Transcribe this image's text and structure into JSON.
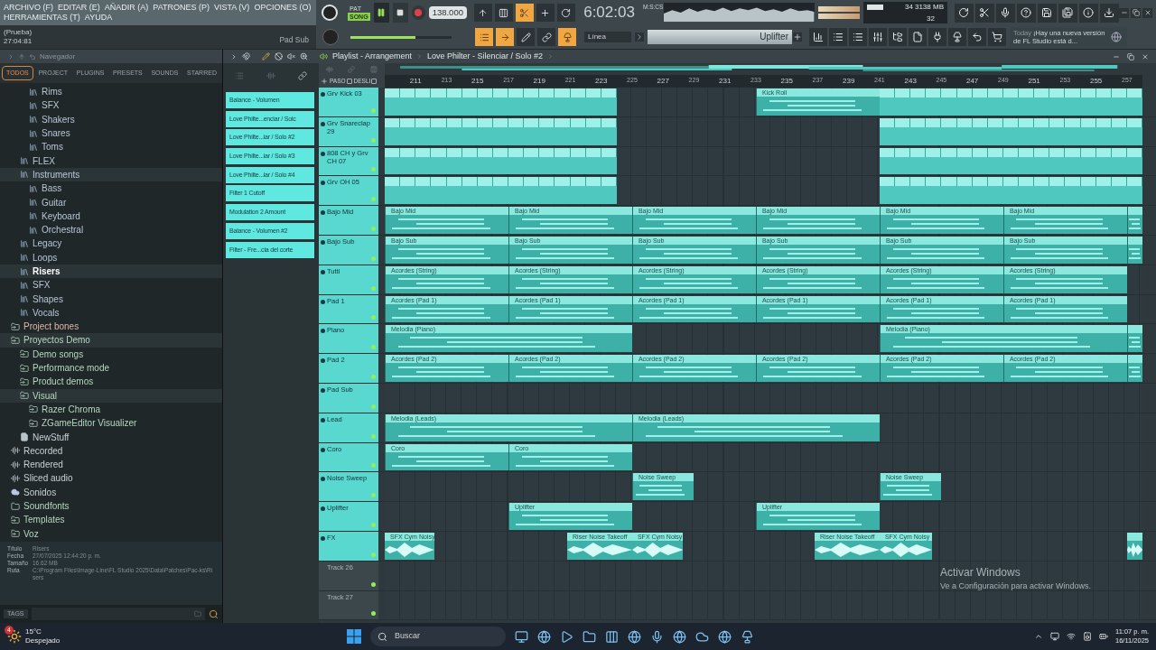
{
  "menu": [
    "ARCHIVO (F)",
    "EDITAR (E)",
    "AÑADIR (A)",
    "PATRONES (P)",
    "VISTA (V)",
    "OPCIONES (O)",
    "HERRAMIENTAS (T)",
    "AYUDA"
  ],
  "hint": {
    "title": "(Prueba)",
    "value": "27:04:81",
    "channel": "Pad Sub"
  },
  "transport": {
    "modes": [
      {
        "label": "PAT",
        "selected": false
      },
      {
        "label": "SONG",
        "selected": true
      }
    ],
    "playing": true,
    "tempo": "138.000",
    "time": "6:02:03",
    "time_unit": "M:S:CS"
  },
  "master_volume": {
    "level": 0.64
  },
  "cpu": {
    "cpu": "34",
    "memory": "3138 MB",
    "polyphony": "32"
  },
  "snap": "Línea",
  "pattern": "Uplifter",
  "news": {
    "day": "Today",
    "text": "¡Hay una nueva versión de FL Studio está d..."
  },
  "browser": {
    "title": "Navegador",
    "tabs": [
      {
        "label": "TODOS",
        "selected": true
      },
      {
        "label": "PROJECT",
        "selected": false
      },
      {
        "label": "PLUGINS",
        "selected": false
      },
      {
        "label": "PRESETS",
        "selected": false
      },
      {
        "label": "SOUNDS",
        "selected": false
      },
      {
        "label": "STARRED",
        "selected": false
      }
    ],
    "tree": [
      {
        "children": [
          {
            "children": [
              {
                "label": "Rims",
                "kind": "pack",
                "selected": false
              },
              {
                "label": "SFX",
                "kind": "pack",
                "selected": false
              },
              {
                "label": "Shakers",
                "kind": "pack",
                "selected": false
              },
              {
                "label": "Snares",
                "kind": "pack",
                "selected": false
              },
              {
                "label": "Toms",
                "kind": "pack",
                "selected": false
              }
            ]
          },
          {
            "label": "FLEX",
            "kind": "pack",
            "selected": false
          },
          {
            "label": "Instruments",
            "kind": "pack",
            "selected": false,
            "children": [
              {
                "label": "Bass",
                "kind": "pack",
                "selected": false
              },
              {
                "label": "Guitar",
                "kind": "pack",
                "selected": false
              },
              {
                "label": "Keyboard",
                "kind": "pack",
                "selected": false
              },
              {
                "label": "Orchestral",
                "kind": "pack",
                "selected": false
              }
            ]
          },
          {
            "label": "Legacy",
            "kind": "pack",
            "selected": false
          },
          {
            "label": "Loops",
            "kind": "pack",
            "selected": false
          },
          {
            "label": "Risers",
            "kind": "pack",
            "selected": true
          },
          {
            "label": "SFX",
            "kind": "pack",
            "selected": false
          },
          {
            "label": "Shapes",
            "kind": "pack",
            "selected": false
          },
          {
            "label": "Vocals",
            "kind": "pack",
            "selected": false
          }
        ]
      },
      {
        "label": "Project bones",
        "kind": "bones",
        "selected": false
      },
      {
        "label": "Proyectos Demo",
        "kind": "folder",
        "selected": false,
        "children": [
          {
            "label": "Demo songs",
            "kind": "folder",
            "selected": false
          },
          {
            "label": "Performance mode",
            "kind": "folder",
            "selected": false
          },
          {
            "label": "Product demos",
            "kind": "folder",
            "selected": false
          },
          {
            "label": "Visual",
            "kind": "folder",
            "selected": false,
            "children": [
              {
                "label": "Razer Chroma",
                "kind": "folder",
                "selected": false
              },
              {
                "label": "ZGameEditor Visualizer",
                "kind": "folder",
                "selected": false
              }
            ]
          },
          {
            "label": "NewStuff",
            "kind": "file",
            "selected": false
          }
        ]
      },
      {
        "label": "Recorded",
        "kind": "audio",
        "selected": false
      },
      {
        "label": "Rendered",
        "kind": "audio",
        "selected": false
      },
      {
        "label": "Sliced audio",
        "kind": "audio",
        "selected": false
      },
      {
        "label": "Sonidos",
        "kind": "cloud",
        "selected": false
      },
      {
        "label": "Soundfonts",
        "kind": "plain",
        "selected": false
      },
      {
        "label": "Templates",
        "kind": "folder",
        "selected": false
      },
      {
        "label": "Voz",
        "kind": "folder",
        "selected": false
      }
    ],
    "info": [
      {
        "label": "Título",
        "value": "Risers"
      },
      {
        "label": "Fecha",
        "value": "27/07/2025 12:44:20 p. m."
      },
      {
        "label": "Tamaño",
        "value": "16.62 MB"
      },
      {
        "label": "Ruta",
        "value": "C:\\Program Files\\Image-Line\\FL Studio 2025\\Data\\Patches\\Pac-ks\\Risers"
      }
    ],
    "tags": "TAGS"
  },
  "playlist": {
    "title": "Playlist - Arrangement",
    "pattern": "Love Philter - Silenciar / Solo #2",
    "step_labels": [
      "PASO",
      "DESLI"
    ],
    "automation": [
      "Balance - Volumen",
      "Love Philte...enciar / Solc",
      "Love Philte...iar / Solo #2",
      "Love Philte...iar / Solo #3",
      "Love Philte...iar / Solo #4",
      "Filter 1 Cutoff",
      "Modulation 2 Amount",
      "Balance - Volumen #2",
      "Filter - Fre...cia del corte"
    ],
    "ruler": [
      "211",
      "213",
      "215",
      "217",
      "219",
      "221",
      "223",
      "225",
      "227",
      "229",
      "231",
      "233",
      "235",
      "237",
      "239",
      "241",
      "243",
      "245",
      "247",
      "249",
      "251",
      "253",
      "255",
      "257"
    ],
    "tracks": [
      {
        "name": "Grv Kick 03",
        "kind": "named",
        "clips": [
          {
            "kind": "beat"
          },
          {
            "kind": "pattern",
            "label": "Kick Roll"
          },
          {
            "kind": "beat"
          }
        ]
      },
      {
        "name": "Grv Snareclap 29",
        "kind": "named",
        "clips": [
          {
            "kind": "beat"
          },
          {
            "kind": "beat"
          }
        ]
      },
      {
        "name": "808 CH y Grv CH 07",
        "kind": "named",
        "clips": [
          {
            "kind": "beat"
          },
          {
            "kind": "beat"
          }
        ]
      },
      {
        "name": "Grv OH 05",
        "kind": "named",
        "clips": [
          {
            "kind": "beat"
          },
          {
            "kind": "beat"
          }
        ]
      },
      {
        "name": "Bajo Mid",
        "kind": "named",
        "clips": [
          {
            "kind": "pattern",
            "label": "Bajo Mid"
          },
          {
            "kind": "pattern",
            "label": "Bajo Mid"
          },
          {
            "kind": "pattern",
            "label": "Bajo Mid"
          },
          {
            "kind": "pattern",
            "label": "Bajo Mid"
          },
          {
            "kind": "pattern",
            "label": "Bajo Mid"
          },
          {
            "kind": "pattern",
            "label": "Bajo Mid"
          },
          {
            "kind": "pattern"
          }
        ]
      },
      {
        "name": "Bajo Sub",
        "kind": "named",
        "clips": [
          {
            "kind": "pattern",
            "label": "Bajo Sub"
          },
          {
            "kind": "pattern",
            "label": "Bajo Sub"
          },
          {
            "kind": "pattern",
            "label": "Bajo Sub"
          },
          {
            "kind": "pattern",
            "label": "Bajo Sub"
          },
          {
            "kind": "pattern",
            "label": "Bajo Sub"
          },
          {
            "kind": "pattern",
            "label": "Bajo Sub"
          },
          {
            "kind": "pattern"
          }
        ]
      },
      {
        "name": "Tutti",
        "kind": "named",
        "clips": [
          {
            "kind": "pattern",
            "label": "Acordes (String)"
          },
          {
            "kind": "pattern",
            "label": "Acordes (String)"
          },
          {
            "kind": "pattern",
            "label": "Acordes (String)"
          },
          {
            "kind": "pattern",
            "label": "Acordes (String)"
          },
          {
            "kind": "pattern",
            "label": "Acordes (String)"
          },
          {
            "kind": "pattern",
            "label": "Acordes (String)"
          }
        ]
      },
      {
        "name": "Pad 1",
        "kind": "named",
        "clips": [
          {
            "kind": "pattern",
            "label": "Acordes (Pad 1)"
          },
          {
            "kind": "pattern",
            "label": "Acordes (Pad 1)"
          },
          {
            "kind": "pattern",
            "label": "Acordes (Pad 1)"
          },
          {
            "kind": "pattern",
            "label": "Acordes (Pad 1)"
          },
          {
            "kind": "pattern",
            "label": "Acordes (Pad 1)"
          },
          {
            "kind": "pattern",
            "label": "Acordes (Pad 1)"
          }
        ]
      },
      {
        "name": "Piano",
        "kind": "named",
        "clips": [
          {
            "kind": "pattern",
            "label": "Melodia (Piano)"
          },
          {
            "kind": "pattern",
            "label": "Melodia (Piano)"
          },
          {
            "kind": "pattern"
          }
        ]
      },
      {
        "name": "Pad 2",
        "kind": "named",
        "clips": [
          {
            "kind": "pattern",
            "label": "Acordes (Pad 2)"
          },
          {
            "kind": "pattern",
            "label": "Acordes (Pad 2)"
          },
          {
            "kind": "pattern",
            "label": "Acordes (Pad 2)"
          },
          {
            "kind": "pattern",
            "label": "Acordes (Pad 2)"
          },
          {
            "kind": "pattern",
            "label": "Acordes (Pad 2)"
          },
          {
            "kind": "pattern",
            "label": "Acordes (Pad 2)"
          },
          {
            "kind": "pattern"
          }
        ]
      },
      {
        "name": "Pad Sub",
        "kind": "named"
      },
      {
        "name": "Lead",
        "kind": "named",
        "clips": [
          {
            "kind": "pattern",
            "label": "Melodia (Leads)"
          },
          {
            "kind": "pattern",
            "label": "Melodia (Leads)"
          }
        ]
      },
      {
        "name": "Coro",
        "kind": "named",
        "clips": [
          {
            "kind": "pattern",
            "label": "Coro"
          },
          {
            "kind": "pattern",
            "label": "Coro"
          }
        ]
      },
      {
        "name": "Noise Sweep",
        "kind": "named",
        "clips": [
          {
            "kind": "pattern",
            "label": "Noise Sweep"
          },
          {
            "kind": "pattern",
            "label": "Noise Sweep"
          }
        ]
      },
      {
        "name": "Uplifter",
        "kind": "named",
        "clips": [
          {
            "kind": "pattern",
            "label": "Uplifter"
          },
          {
            "kind": "pattern",
            "label": "Uplifter"
          }
        ]
      },
      {
        "name": "FX",
        "kind": "named",
        "clips": [
          {
            "kind": "audio",
            "label": "SFX Cym Noisy"
          },
          {
            "kind": "audio",
            "label": "Riser Noise Takeoff"
          },
          {
            "kind": "audio",
            "label": "SFX Cym Noisy"
          },
          {
            "kind": "audio",
            "label": "Riser Noise Takeoff"
          },
          {
            "kind": "audio",
            "label": "SFX Cym Noisy"
          },
          {
            "kind": "audio"
          }
        ]
      },
      {
        "name": "Track 26",
        "kind": "default"
      },
      {
        "name": "Track 27",
        "kind": "default"
      }
    ]
  },
  "windows_notice": {
    "title": "Activar Windows",
    "text": "Ve a Configuración para activar Windows."
  },
  "taskbar": {
    "temperature": "15°C",
    "weather": "Despejado",
    "badge": "4",
    "search": "Buscar",
    "time": "11:07 p. m.",
    "date": "16/11/2025"
  }
}
